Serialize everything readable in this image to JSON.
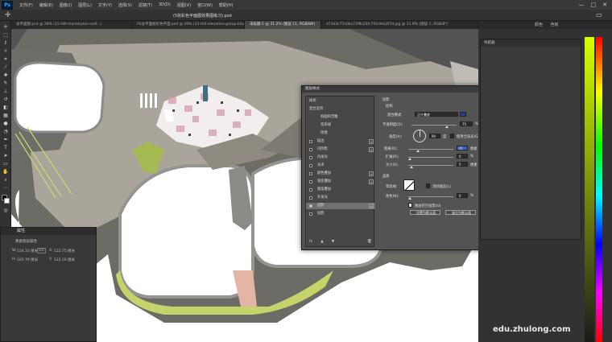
{
  "app": {
    "logo": "Ps",
    "window_controls": [
      "—",
      "□",
      "✕"
    ]
  },
  "menu": [
    "文件(F)",
    "编辑(E)",
    "图像(I)",
    "图层(L)",
    "文字(Y)",
    "选择(S)",
    "滤镜(T)",
    "3D(D)",
    "视图(V)",
    "窗口(W)",
    "帮助(H)"
  ],
  "options_bar": {
    "doc_title": "(5张彩色平面图效果图练习).psd",
    "move_icon": "move-icon"
  },
  "tabs": [
    {
      "label": "总平面图.psd @ 28% (15-Hill-masterplan-roof...)",
      "active": false
    },
    {
      "label": "PS总平面图彩色平面.psd @ 29% (15-Hill-elevation-group-black and white-texture adjusted-with-Hide-8.png, RGB/8*)",
      "active": false
    },
    {
      "label": "未标题-1 @ 31.2% (图层 11, RGB/8#)",
      "active": true
    },
    {
      "label": "473d3c75c0bc72f8c23fc7f3c0ea3f7d.jpg @ 11.9% (图层 1, RGB/8*)",
      "active": false
    }
  ],
  "properties": {
    "title": "属性",
    "subtitle": "像素图层属性",
    "w_label": "W:",
    "w_value": "134.33 厘米",
    "h_label": "H:",
    "h_value": "103.79 厘米",
    "x_label": "X:",
    "x_value": "122.75 厘米",
    "y_label": "Y:",
    "y_value": "122.16 厘米",
    "link_label": "GO"
  },
  "dialog": {
    "title": "图层样式",
    "close": "✕",
    "styles_header": "样式",
    "blend_header": "混合选项",
    "items": [
      {
        "label": "斜面和浮雕",
        "checked": false,
        "plus": false,
        "indent": true
      },
      {
        "label": "等高线",
        "checked": false,
        "plus": false,
        "indent": true
      },
      {
        "label": "纹理",
        "checked": false,
        "plus": false,
        "indent": true
      },
      {
        "label": "描边",
        "checked": false,
        "plus": true
      },
      {
        "label": "内阴影",
        "checked": false,
        "plus": true
      },
      {
        "label": "内发光",
        "checked": false,
        "plus": false
      },
      {
        "label": "光泽",
        "checked": false,
        "plus": false
      },
      {
        "label": "颜色叠加",
        "checked": false,
        "plus": true
      },
      {
        "label": "渐变叠加",
        "checked": false,
        "plus": true
      },
      {
        "label": "图案叠加",
        "checked": false,
        "plus": false
      },
      {
        "label": "外发光",
        "checked": false,
        "plus": false
      },
      {
        "label": "投影",
        "checked": true,
        "plus": true,
        "selected": true
      },
      {
        "label": "投影",
        "checked": false,
        "plus": false
      }
    ],
    "footer_icons": [
      "fx",
      "▲",
      "▼",
      "🗑"
    ],
    "section_title": "投影",
    "structure_title": "结构",
    "blend_mode_label": "混合模式:",
    "blend_mode_value": "正片叠底",
    "opacity_label": "不透明度(O):",
    "opacity_value": "75",
    "angle_label": "角度(A):",
    "angle_value": "90",
    "global_light_label": "使用全局光(G)",
    "distance_label": "距离(D):",
    "distance_value": "41",
    "distance_unit": "像素",
    "spread_label": "扩展(R):",
    "spread_value": "0",
    "size_label": "大小(S):",
    "size_value": "5",
    "quality_title": "品质",
    "contour_label": "等高线:",
    "antialias_label": "消除锯齿(L)",
    "noise_label": "杂色(N):",
    "noise_value": "0",
    "knockout_label": "图层挖空投影(U)",
    "default_btn": "设置为默认值",
    "reset_btn": "复位为默认值",
    "ok": "确定",
    "cancel": "取消",
    "new_style": "新建样式(W)...",
    "preview_label": "预览(V)",
    "percent": "%",
    "degree": "度"
  },
  "right_panel": {
    "tabs": [
      "颜色",
      "色板"
    ],
    "hist_title": "导航器"
  },
  "watermark": "edu.zhulong.com"
}
